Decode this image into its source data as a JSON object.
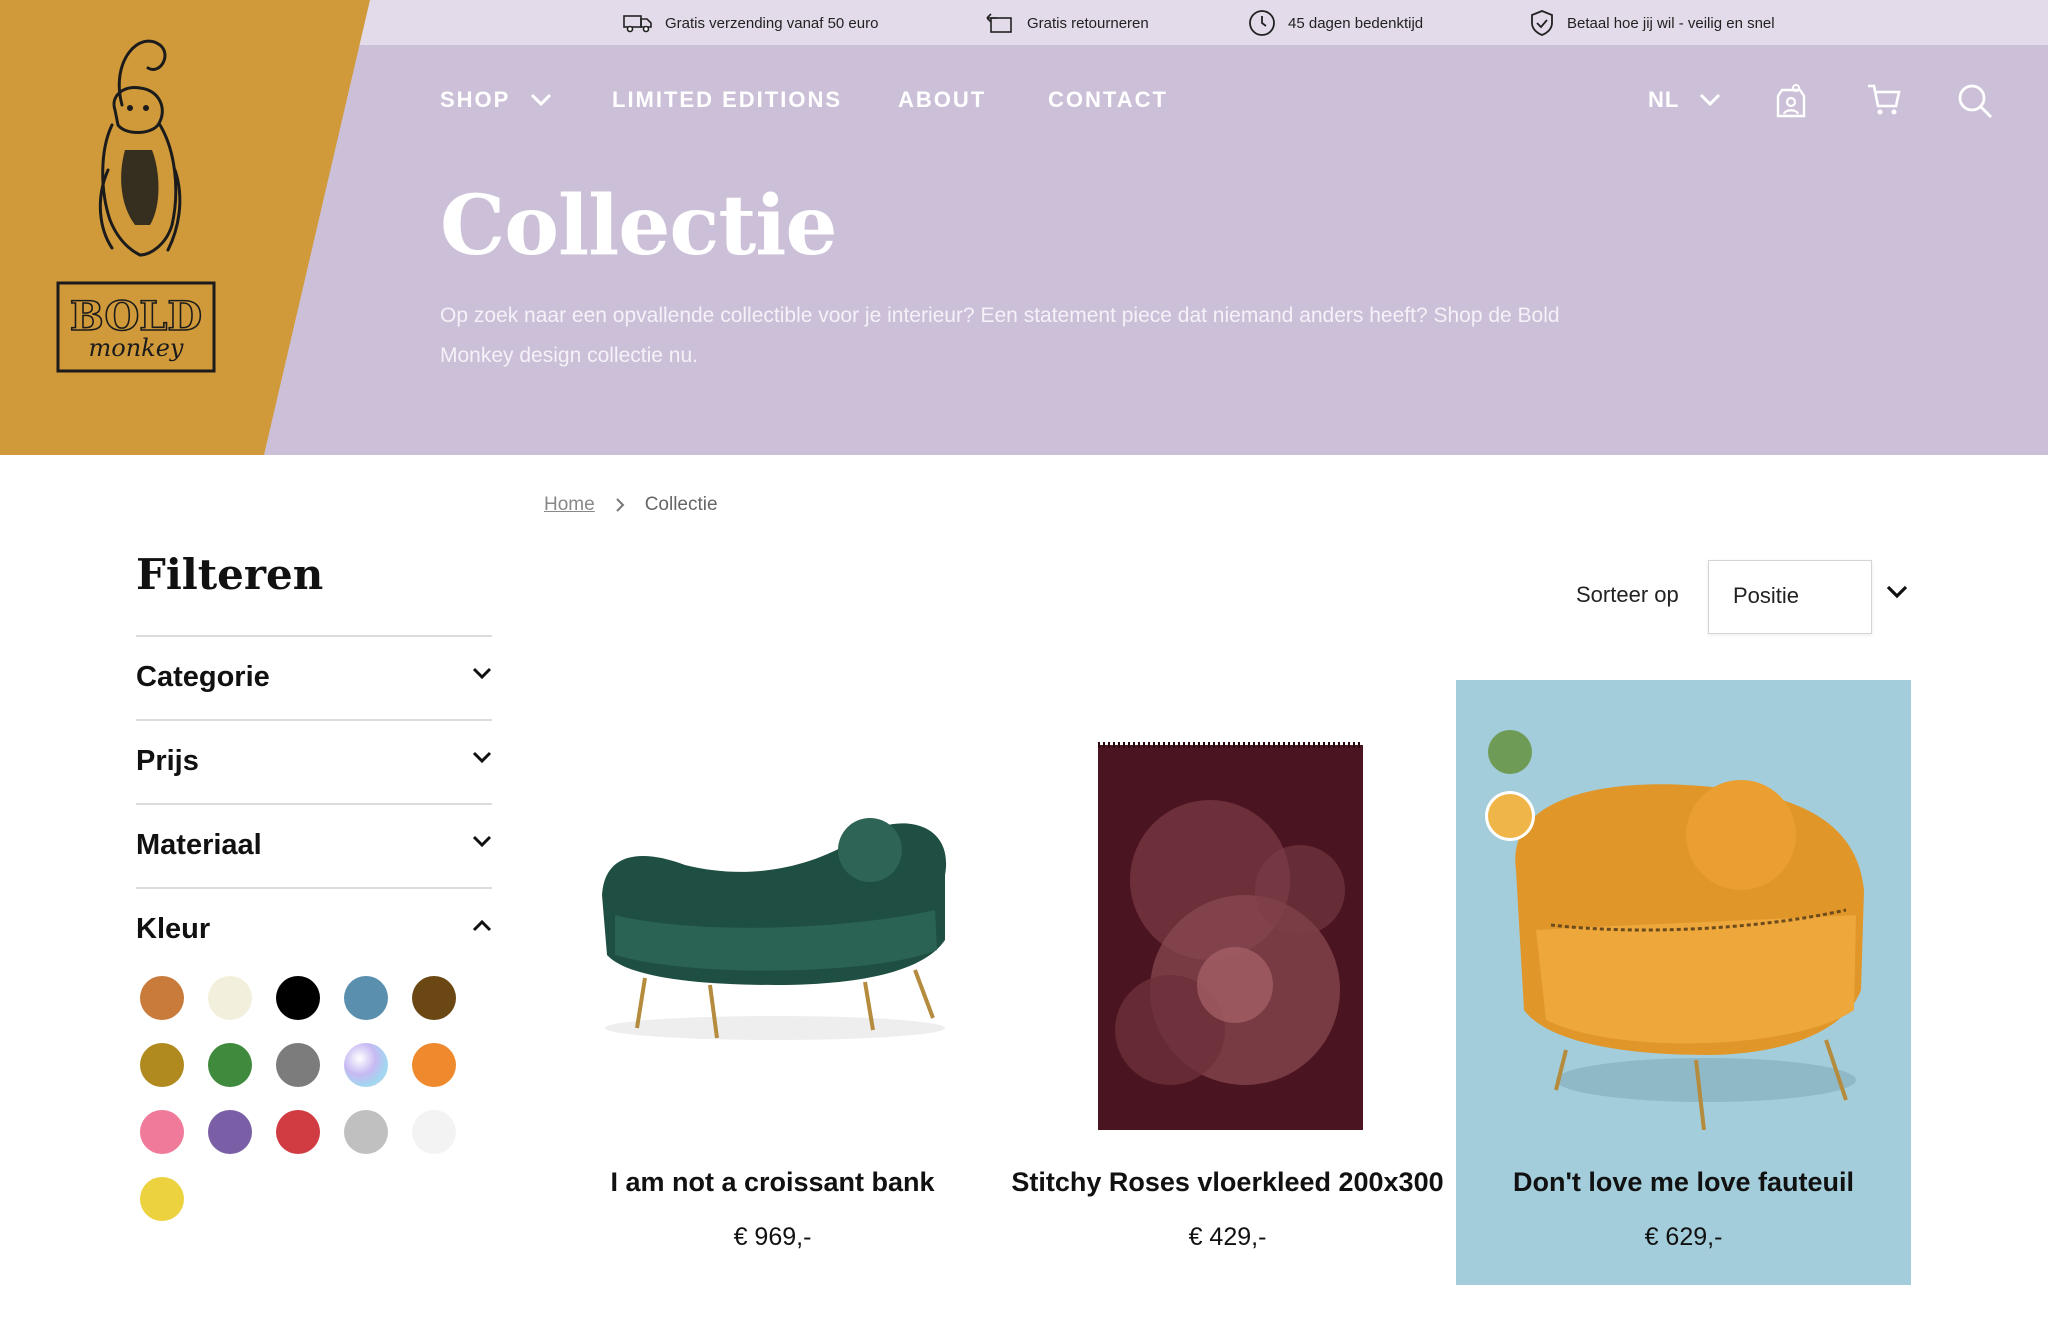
{
  "usp_bar": {
    "items": [
      {
        "icon": "truck-icon",
        "text": "Gratis verzending vanaf 50 euro"
      },
      {
        "icon": "return-icon",
        "text": "Gratis retourneren"
      },
      {
        "icon": "clock-icon",
        "text": "45 dagen bedenktijd"
      },
      {
        "icon": "shield-check-icon",
        "text": "Betaal hoe jij wil - veilig en snel"
      }
    ]
  },
  "brand": {
    "logo_text_top": "BOLD",
    "logo_text_bottom": "monkey"
  },
  "nav": {
    "shop": "SHOP",
    "limited": "LIMITED EDITIONS",
    "about": "ABOUT",
    "contact": "CONTACT",
    "language": "NL"
  },
  "hero": {
    "title": "Collectie",
    "text": "Op zoek naar een opvallende collectible voor je interieur? Een statement piece dat niemand anders heeft? Shop de Bold Monkey design collectie nu."
  },
  "breadcrumb": {
    "home": "Home",
    "current": "Collectie"
  },
  "filters": {
    "title": "Filteren",
    "groups": [
      {
        "label": "Categorie",
        "open": false
      },
      {
        "label": "Prijs",
        "open": false
      },
      {
        "label": "Materiaal",
        "open": false
      },
      {
        "label": "Kleur",
        "open": true
      }
    ],
    "colors": [
      "#c97b3c",
      "#f2f0dc",
      "#000000",
      "#5b8fae",
      "#6b4713",
      "#b08a1f",
      "#3f8a3c",
      "#7c7c7c",
      "iridescent",
      "#ee8a2d",
      "#ef7a9a",
      "#7a5ea6",
      "#d13c42",
      "#c0c0c0",
      "#f3f3f3",
      "#ecd23f"
    ]
  },
  "sort": {
    "label": "Sorteer op",
    "value": "Positie"
  },
  "products": [
    {
      "name": "I am not a croissant bank",
      "price": "€ 969,-"
    },
    {
      "name": "Stitchy Roses vloerkleed 200x300",
      "price": "€ 429,-"
    },
    {
      "name": "Don't love me love fauteuil",
      "price": "€ 629,-",
      "variant_colors": [
        "#6e9b55",
        "#f0b548"
      ]
    }
  ]
}
